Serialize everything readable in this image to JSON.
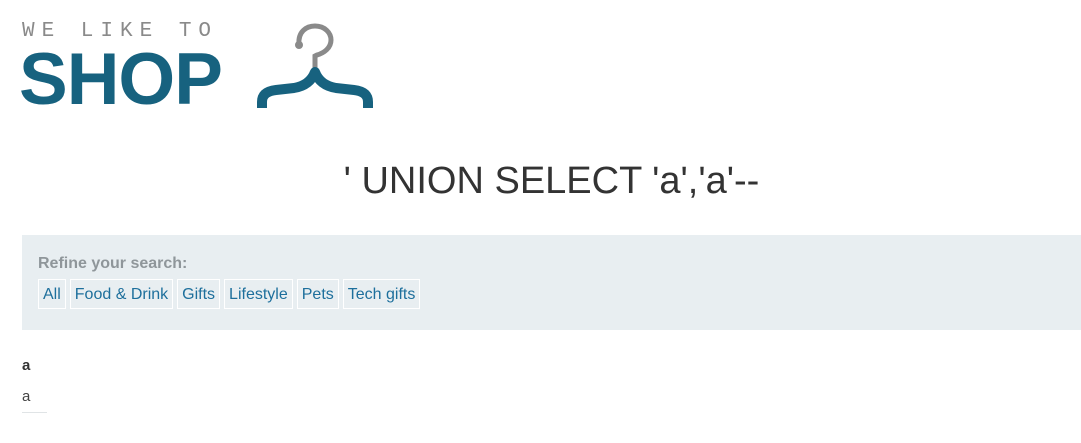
{
  "logo": {
    "tagline": "WE LIKE TO",
    "word": "SHOP",
    "icon": "hanger-icon",
    "brand_color": "#17627f",
    "tagline_color": "#8a8a8a"
  },
  "search": {
    "title": "' UNION SELECT 'a','a'--"
  },
  "filters": {
    "label": "Refine your search:",
    "items": [
      {
        "label": "All"
      },
      {
        "label": "Food & Drink"
      },
      {
        "label": "Gifts"
      },
      {
        "label": "Lifestyle"
      },
      {
        "label": "Pets"
      },
      {
        "label": "Tech gifts"
      }
    ],
    "link_color": "#1d6f9c",
    "panel_color": "#e8eef1"
  },
  "results": [
    {
      "heading": "a",
      "value": "a"
    }
  ]
}
